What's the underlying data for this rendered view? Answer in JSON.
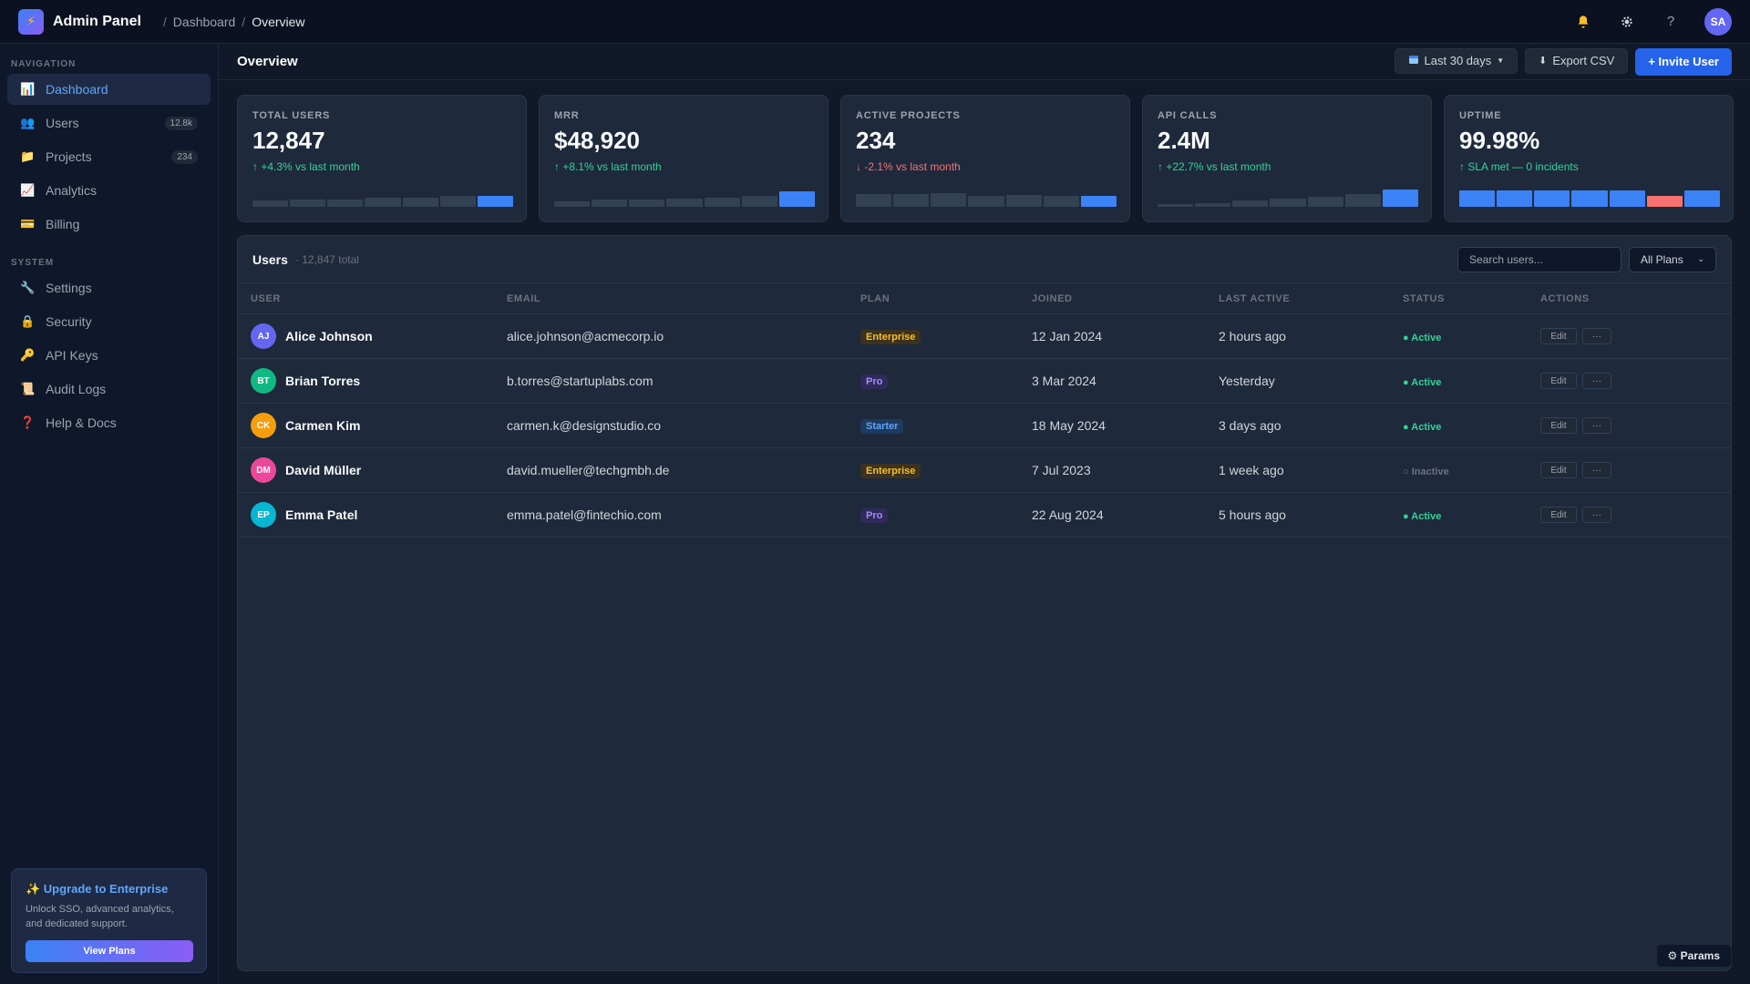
{
  "app": {
    "title": "Admin Panel",
    "logo_icon": "⚡"
  },
  "breadcrumb": {
    "sep1": "/",
    "item1": "Dashboard",
    "sep2": "/",
    "current": "Overview"
  },
  "topbar": {
    "avatar_initials": "SA"
  },
  "sidebar": {
    "nav_heading": "NAVIGATION",
    "nav_items": [
      {
        "label": "Dashboard",
        "icon": "📊",
        "active": true
      },
      {
        "label": "Users",
        "icon": "👥",
        "badge": "12.8k"
      },
      {
        "label": "Projects",
        "icon": "📁",
        "badge": "234"
      },
      {
        "label": "Analytics",
        "icon": "📈"
      },
      {
        "label": "Billing",
        "icon": "💳"
      }
    ],
    "system_heading": "SYSTEM",
    "system_items": [
      {
        "label": "Settings",
        "icon": "🔧"
      },
      {
        "label": "Security",
        "icon": "🔒"
      },
      {
        "label": "API Keys",
        "icon": "🔑"
      },
      {
        "label": "Audit Logs",
        "icon": "📜"
      },
      {
        "label": "Help & Docs",
        "icon": "❓"
      }
    ],
    "upgrade": {
      "title": "✨ Upgrade to Enterprise",
      "text": "Unlock SSO, advanced analytics, and dedicated support.",
      "button": "View Plans"
    }
  },
  "main": {
    "title": "Overview",
    "date_range": "Last 30 days",
    "export_label": "Export CSV",
    "invite_label": "+ Invite User"
  },
  "stats": [
    {
      "label": "TOTAL USERS",
      "value": "12,847",
      "delta": "↑ +4.3% vs last month",
      "trend": "up",
      "spark": [
        0.3,
        0.35,
        0.35,
        0.45,
        0.45,
        0.55,
        0.55
      ],
      "spark_colors": [
        "#334155",
        "#334155",
        "#334155",
        "#334155",
        "#334155",
        "#334155",
        "#3b82f6"
      ]
    },
    {
      "label": "MRR",
      "value": "$48,920",
      "delta": "↑ +8.1% vs last month",
      "trend": "up",
      "spark": [
        0.25,
        0.35,
        0.35,
        0.4,
        0.45,
        0.55,
        0.75
      ],
      "spark_colors": [
        "#334155",
        "#334155",
        "#334155",
        "#334155",
        "#334155",
        "#334155",
        "#3b82f6"
      ]
    },
    {
      "label": "ACTIVE PROJECTS",
      "value": "234",
      "delta": "↓ -2.1% vs last month",
      "trend": "down",
      "spark": [
        0.65,
        0.65,
        0.7,
        0.55,
        0.6,
        0.55,
        0.55
      ],
      "spark_colors": [
        "#334155",
        "#334155",
        "#334155",
        "#334155",
        "#334155",
        "#334155",
        "#3b82f6"
      ]
    },
    {
      "label": "API CALLS",
      "value": "2.4M",
      "delta": "↑ +22.7% vs last month",
      "trend": "up",
      "spark": [
        0.15,
        0.2,
        0.3,
        0.4,
        0.5,
        0.65,
        0.85
      ],
      "spark_colors": [
        "#334155",
        "#334155",
        "#334155",
        "#334155",
        "#334155",
        "#334155",
        "#3b82f6"
      ]
    },
    {
      "label": "UPTIME",
      "value": "99.98%",
      "delta": "↑ SLA met — 0 incidents",
      "trend": "up",
      "spark": [
        0.8,
        0.8,
        0.8,
        0.8,
        0.8,
        0.55,
        0.8
      ],
      "spark_colors": [
        "#3b82f6",
        "#3b82f6",
        "#3b82f6",
        "#3b82f6",
        "#3b82f6",
        "#f87171",
        "#3b82f6"
      ]
    }
  ],
  "table": {
    "title": "Users",
    "subtitle": "· 12,847 total",
    "search_placeholder": "Search users...",
    "plan_filter": "All Plans",
    "columns": [
      "USER",
      "EMAIL",
      "PLAN",
      "JOINED",
      "LAST ACTIVE",
      "STATUS",
      "ACTIONS"
    ],
    "rows": [
      {
        "initials": "AJ",
        "avatar_color": "#6366f1",
        "name": "Alice Johnson",
        "email": "alice.johnson@acmecorp.io",
        "plan": "Enterprise",
        "joined": "12 Jan 2024",
        "last_active": "2 hours ago",
        "status": "● Active"
      },
      {
        "initials": "BT",
        "avatar_color": "#10b981",
        "name": "Brian Torres",
        "email": "b.torres@startuplabs.com",
        "plan": "Pro",
        "joined": "3 Mar 2024",
        "last_active": "Yesterday",
        "status": "● Active"
      },
      {
        "initials": "CK",
        "avatar_color": "#f59e0b",
        "name": "Carmen Kim",
        "email": "carmen.k@designstudio.co",
        "plan": "Starter",
        "joined": "18 May 2024",
        "last_active": "3 days ago",
        "status": "● Active"
      },
      {
        "initials": "DM",
        "avatar_color": "#ec4899",
        "name": "David Müller",
        "email": "david.mueller@techgmbh.de",
        "plan": "Enterprise",
        "joined": "7 Jul 2023",
        "last_active": "1 week ago",
        "status": "○ Inactive"
      },
      {
        "initials": "EP",
        "avatar_color": "#06b6d4",
        "name": "Emma Patel",
        "email": "emma.patel@fintechio.com",
        "plan": "Pro",
        "joined": "22 Aug 2024",
        "last_active": "5 hours ago",
        "status": "● Active"
      }
    ],
    "edit_label": "Edit",
    "more_label": "···"
  },
  "plan_colors": {
    "Enterprise": {
      "bg": "#3b3220",
      "fg": "#fbbf24"
    },
    "Pro": {
      "bg": "#2e2a5a",
      "fg": "#a78bfa"
    },
    "Starter": {
      "bg": "#1e3a5f",
      "fg": "#60a5fa"
    }
  },
  "status_colors": {
    "active": "#34d399",
    "inactive": "#6b7280"
  },
  "params_label": "⚙ Params"
}
